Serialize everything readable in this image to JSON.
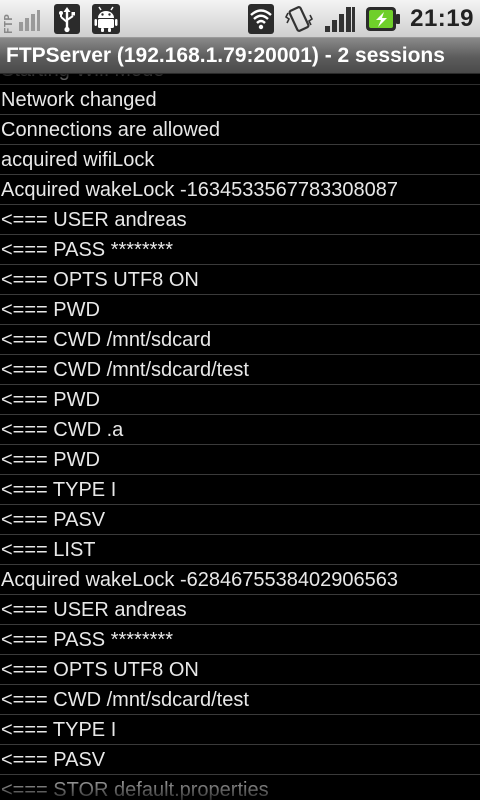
{
  "status_bar": {
    "ftp_badge": "FTP",
    "icons_left": [
      "ftp-server-icon",
      "usb-icon",
      "android-debug-icon"
    ],
    "icons_right": [
      "wifi-icon",
      "vibrate-icon",
      "signal-icon",
      "battery-charging-icon"
    ],
    "clock": "21:19"
  },
  "title_bar": {
    "title": "FTPServer (192.168.1.79:20001) - 2 sessions"
  },
  "log": {
    "lines": [
      "Starting Wifi Mode",
      "Network changed",
      "Connections are allowed",
      "acquired wifiLock",
      "Acquired wakeLock -1634533567783308087",
      "<=== USER andreas",
      "<=== PASS ********",
      "<=== OPTS UTF8 ON",
      "<=== PWD",
      "<=== CWD /mnt/sdcard",
      "<=== CWD /mnt/sdcard/test",
      "<=== PWD",
      "<=== CWD .a",
      "<=== PWD",
      "<=== TYPE I",
      "<=== PASV",
      "<=== LIST",
      "Acquired wakeLock -6284675538402906563",
      "<=== USER andreas",
      "<=== PASS ********",
      "<=== OPTS UTF8 ON",
      "<=== CWD /mnt/sdcard/test",
      "<=== TYPE I",
      "<=== PASV",
      "<=== STOR default.properties"
    ]
  }
}
